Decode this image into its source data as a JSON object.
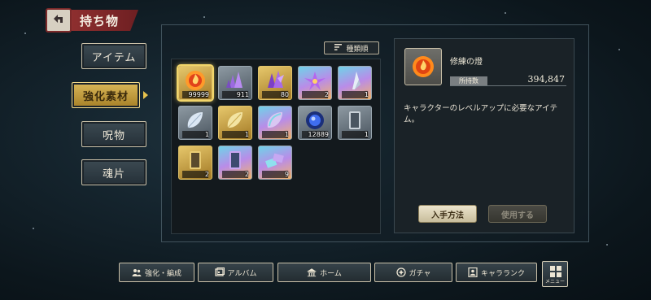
{
  "header": {
    "title": "持ち物"
  },
  "tabs": [
    {
      "label": "アイテム",
      "active": false
    },
    {
      "label": "強化素材",
      "active": true
    },
    {
      "label": "呪物",
      "active": false
    },
    {
      "label": "魂片",
      "active": false
    }
  ],
  "sort": {
    "label": "種類順"
  },
  "items": [
    {
      "count": "99999",
      "kind": "flame-orb",
      "frame": "gold",
      "selected": true
    },
    {
      "count": "911",
      "kind": "purple-crystal-small",
      "frame": "silver"
    },
    {
      "count": "80",
      "kind": "purple-crystal-gold",
      "frame": "gold"
    },
    {
      "count": "2",
      "kind": "purple-crystal-burst",
      "frame": "rainbow"
    },
    {
      "count": "1",
      "kind": "white-shard",
      "frame": "rainbow"
    },
    {
      "count": "1",
      "kind": "white-leaf",
      "frame": "silver"
    },
    {
      "count": "1",
      "kind": "gold-leaf",
      "frame": "gold"
    },
    {
      "count": "1",
      "kind": "rainbow-leaf",
      "frame": "rainbow"
    },
    {
      "count": "12889",
      "kind": "blue-orb",
      "frame": "silver"
    },
    {
      "count": "1",
      "kind": "silver-mirror",
      "frame": "silver"
    },
    {
      "count": "2",
      "kind": "gold-mirror",
      "frame": "gold"
    },
    {
      "count": "2",
      "kind": "rainbow-mirror",
      "frame": "rainbow"
    },
    {
      "count": "9",
      "kind": "rainbow-tablets",
      "frame": "rainbow"
    }
  ],
  "detail": {
    "name": "修練の燈",
    "held_label": "所持数",
    "held_value": "394,847",
    "description": "キャラクターのレベルアップに必要なアイテム。",
    "obtain_label": "入手方法",
    "use_label": "使用する"
  },
  "nav": [
    {
      "label": "強化・編成",
      "icon": "party-icon"
    },
    {
      "label": "アルバム",
      "icon": "album-icon"
    },
    {
      "label": "ホーム",
      "icon": "home-icon"
    },
    {
      "label": "ガチャ",
      "icon": "gacha-icon"
    },
    {
      "label": "キャラランク",
      "icon": "rank-icon"
    }
  ],
  "menu": {
    "label": "メニュー"
  }
}
